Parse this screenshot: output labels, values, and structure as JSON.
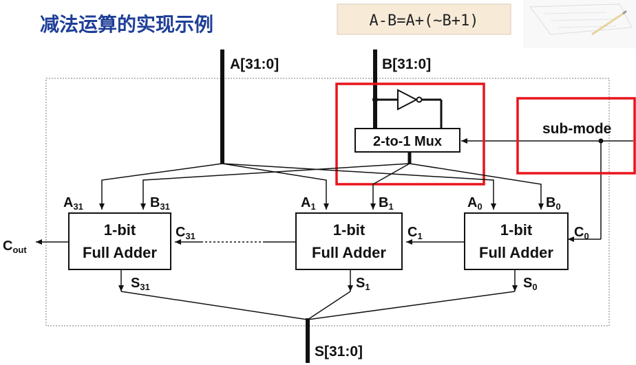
{
  "title": "减法运算的实现示例",
  "formula": "A-B=A+(~B+1)",
  "buses": {
    "a": "A[31:0]",
    "b": "B[31:0]",
    "s": "S[31:0]"
  },
  "mux_label": "2-to-1 Mux",
  "sub_mode_label": "sub-mode",
  "cout": {
    "base": "C",
    "sub": "out"
  },
  "adders": [
    {
      "line1": "1-bit",
      "line2": "Full Adder",
      "a": {
        "base": "A",
        "sub": "31"
      },
      "b": {
        "base": "B",
        "sub": "31"
      },
      "c": {
        "base": "C",
        "sub": "31"
      },
      "s": {
        "base": "S",
        "sub": "31"
      }
    },
    {
      "line1": "1-bit",
      "line2": "Full Adder",
      "a": {
        "base": "A",
        "sub": "1"
      },
      "b": {
        "base": "B",
        "sub": "1"
      },
      "c": {
        "base": "C",
        "sub": "1"
      },
      "s": {
        "base": "S",
        "sub": "1"
      }
    },
    {
      "line1": "1-bit",
      "line2": "Full Adder",
      "a": {
        "base": "A",
        "sub": "0"
      },
      "b": {
        "base": "B",
        "sub": "0"
      },
      "c": {
        "base": "C",
        "sub": "0"
      },
      "s": {
        "base": "S",
        "sub": "0"
      }
    }
  ],
  "colors": {
    "title": "#1f3f98",
    "highlight": "#e8141b",
    "formula_bg": "#f7ebd8"
  }
}
